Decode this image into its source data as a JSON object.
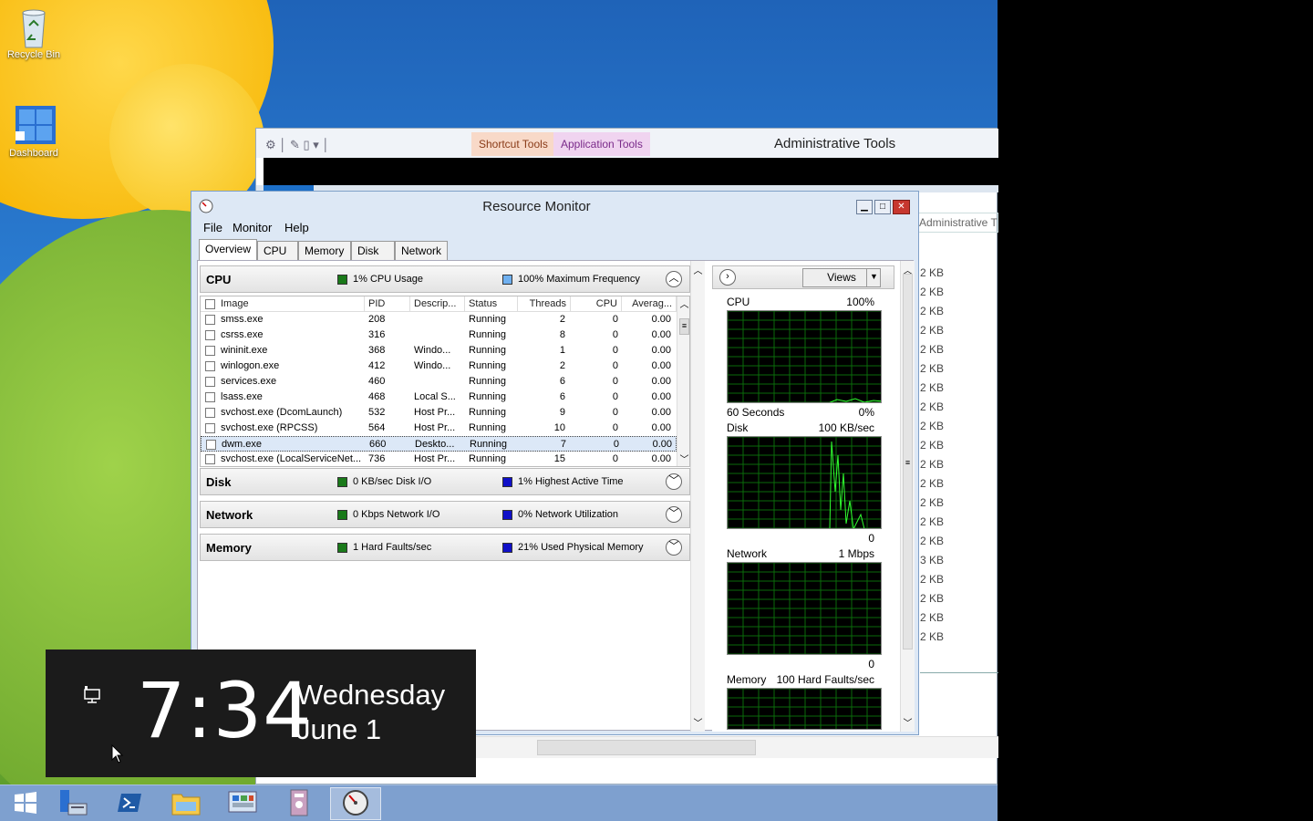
{
  "desktop": {
    "icons": [
      {
        "label": "Recycle Bin",
        "icon": "recycle-bin-icon"
      },
      {
        "label": "Dashboard",
        "icon": "dashboard-icon"
      }
    ]
  },
  "admin_window": {
    "contextual_tabs": [
      "Shortcut Tools",
      "Application Tools"
    ],
    "title": "Administrative Tools",
    "address_partial": "Administrative T",
    "sizes": [
      "2 KB",
      "2 KB",
      "2 KB",
      "2 KB",
      "2 KB",
      "2 KB",
      "2 KB",
      "2 KB",
      "2 KB",
      "2 KB",
      "2 KB",
      "2 KB",
      "2 KB",
      "2 KB",
      "2 KB",
      "3 KB",
      "2 KB",
      "2 KB",
      "2 KB",
      "2 KB"
    ]
  },
  "resource_monitor": {
    "title": "Resource Monitor",
    "menu": [
      "File",
      "Monitor",
      "Help"
    ],
    "tabs": [
      "Overview",
      "CPU",
      "Memory",
      "Disk",
      "Network"
    ],
    "active_tab": "Overview",
    "cpu": {
      "title": "CPU",
      "stat1": "1% CPU Usage",
      "stat2": "100% Maximum Frequency",
      "columns": [
        "Image",
        "PID",
        "Descrip...",
        "Status",
        "Threads",
        "CPU",
        "Averag..."
      ],
      "rows": [
        {
          "image": "smss.exe",
          "pid": "208",
          "desc": "",
          "status": "Running",
          "threads": "2",
          "cpu": "0",
          "avg": "0.00"
        },
        {
          "image": "csrss.exe",
          "pid": "316",
          "desc": "",
          "status": "Running",
          "threads": "8",
          "cpu": "0",
          "avg": "0.00"
        },
        {
          "image": "wininit.exe",
          "pid": "368",
          "desc": "Windo...",
          "status": "Running",
          "threads": "1",
          "cpu": "0",
          "avg": "0.00"
        },
        {
          "image": "winlogon.exe",
          "pid": "412",
          "desc": "Windo...",
          "status": "Running",
          "threads": "2",
          "cpu": "0",
          "avg": "0.00"
        },
        {
          "image": "services.exe",
          "pid": "460",
          "desc": "",
          "status": "Running",
          "threads": "6",
          "cpu": "0",
          "avg": "0.00"
        },
        {
          "image": "lsass.exe",
          "pid": "468",
          "desc": "Local S...",
          "status": "Running",
          "threads": "6",
          "cpu": "0",
          "avg": "0.00"
        },
        {
          "image": "svchost.exe (DcomLaunch)",
          "pid": "532",
          "desc": "Host Pr...",
          "status": "Running",
          "threads": "9",
          "cpu": "0",
          "avg": "0.00"
        },
        {
          "image": "svchost.exe (RPCSS)",
          "pid": "564",
          "desc": "Host Pr...",
          "status": "Running",
          "threads": "10",
          "cpu": "0",
          "avg": "0.00"
        },
        {
          "image": "dwm.exe",
          "pid": "660",
          "desc": "Deskto...",
          "status": "Running",
          "threads": "7",
          "cpu": "0",
          "avg": "0.00",
          "selected": true
        },
        {
          "image": "svchost.exe (LocalServiceNet...",
          "pid": "736",
          "desc": "Host Pr...",
          "status": "Running",
          "threads": "15",
          "cpu": "0",
          "avg": "0.00"
        }
      ]
    },
    "disk": {
      "title": "Disk",
      "stat1": "0 KB/sec Disk I/O",
      "stat2": "1% Highest Active Time"
    },
    "network": {
      "title": "Network",
      "stat1": "0 Kbps Network I/O",
      "stat2": "0% Network Utilization"
    },
    "memory": {
      "title": "Memory",
      "stat1": "1 Hard Faults/sec",
      "stat2": "21% Used Physical Memory"
    },
    "graphs_panel": {
      "views_label": "Views",
      "cpu": {
        "label": "CPU",
        "max": "100%",
        "footer_left": "60 Seconds",
        "footer_right": "0%"
      },
      "disk": {
        "label": "Disk",
        "max": "100 KB/sec",
        "footer_right": "0"
      },
      "network": {
        "label": "Network",
        "max": "1 Mbps",
        "footer_right": "0"
      },
      "memory": {
        "label": "Memory",
        "max": "100 Hard Faults/sec"
      }
    },
    "colors": {
      "green": "#1a7a1a",
      "blue": "#1010c8",
      "lightblue": "#6fb0f0",
      "graph_line": "#30ff30"
    }
  },
  "clock": {
    "time": "7:34",
    "day": "Wednesday",
    "date": "June 1"
  },
  "taskbar": {
    "items": [
      "start-icon",
      "server-manager-icon",
      "powershell-icon",
      "file-explorer-icon",
      "control-panel-icon",
      "admin-tools-icon",
      "resource-monitor-icon"
    ]
  }
}
